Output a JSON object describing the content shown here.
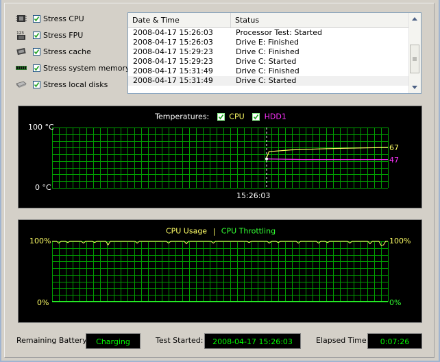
{
  "options": [
    {
      "label": "Stress CPU",
      "icon": "cpu-chip-icon",
      "checked": true
    },
    {
      "label": "Stress FPU",
      "icon": "fpu-calc-icon",
      "checked": true
    },
    {
      "label": "Stress cache",
      "icon": "cache-chip-icon",
      "checked": true
    },
    {
      "label": "Stress system memory",
      "icon": "memory-module-icon",
      "checked": true
    },
    {
      "label": "Stress local disks",
      "icon": "disk-drive-icon",
      "checked": true
    }
  ],
  "log": {
    "columns": [
      "Date & Time",
      "Status"
    ],
    "rows": [
      {
        "time": "2008-04-17 15:26:03",
        "status": "Processor Test: Started"
      },
      {
        "time": "2008-04-17 15:26:03",
        "status": "Drive E: Finished"
      },
      {
        "time": "2008-04-17 15:29:23",
        "status": "Drive C: Finished"
      },
      {
        "time": "2008-04-17 15:29:23",
        "status": "Drive C: Started"
      },
      {
        "time": "2008-04-17 15:31:49",
        "status": "Drive C: Finished"
      },
      {
        "time": "2008-04-17 15:31:49",
        "status": "Drive C: Started"
      }
    ]
  },
  "temperature_chart": {
    "legend_label": "Temperatures:",
    "series_labels": [
      "CPU",
      "HDD1"
    ],
    "y_max_label": "100 °C",
    "y_min_label": "0 °C",
    "marker_time": "15:26:03",
    "cpu_value": "67",
    "hdd_value": "47"
  },
  "usage_chart": {
    "legend_usage": "CPU Usage",
    "legend_sep": "|",
    "legend_throttling": "CPU Throttling",
    "left_max": "100%",
    "left_min": "0%",
    "right_max": "100%",
    "right_min": "0%"
  },
  "chart_data": [
    {
      "type": "line",
      "series": [
        {
          "name": "CPU",
          "x": [
            "15:26:03",
            "end"
          ],
          "values": [
            [
              0,
              50
            ],
            [
              0.02,
              60
            ],
            [
              0.2,
              63
            ],
            [
              0.5,
              65
            ],
            [
              1,
              67
            ]
          ],
          "color": "#ffff66"
        },
        {
          "name": "HDD1",
          "x": [
            "15:26:03",
            "end"
          ],
          "values": [
            [
              0,
              48
            ],
            [
              0.3,
              47
            ],
            [
              1,
              47
            ]
          ],
          "color": "#ff33ff"
        }
      ],
      "ylim": [
        0,
        100
      ],
      "grid": true,
      "colors": {
        "grid": "#00a000",
        "cpu": "#ffff66",
        "hdd": "#ff33ff"
      }
    },
    {
      "type": "line",
      "series": [
        {
          "name": "CPU Usage",
          "values_note": "mostly 100% with brief dips",
          "color": "#ffff66"
        },
        {
          "name": "CPU Throttling",
          "color": "#33ff33"
        }
      ],
      "ylim": [
        0,
        100
      ],
      "grid": true
    }
  ],
  "status": {
    "battery_label": "Remaining Battery:",
    "battery_value": "Charging",
    "started_label": "Test Started:",
    "started_value": "2008-04-17 15:26:03",
    "elapsed_label": "Elapsed Time:",
    "elapsed_value": "0:07:26"
  }
}
